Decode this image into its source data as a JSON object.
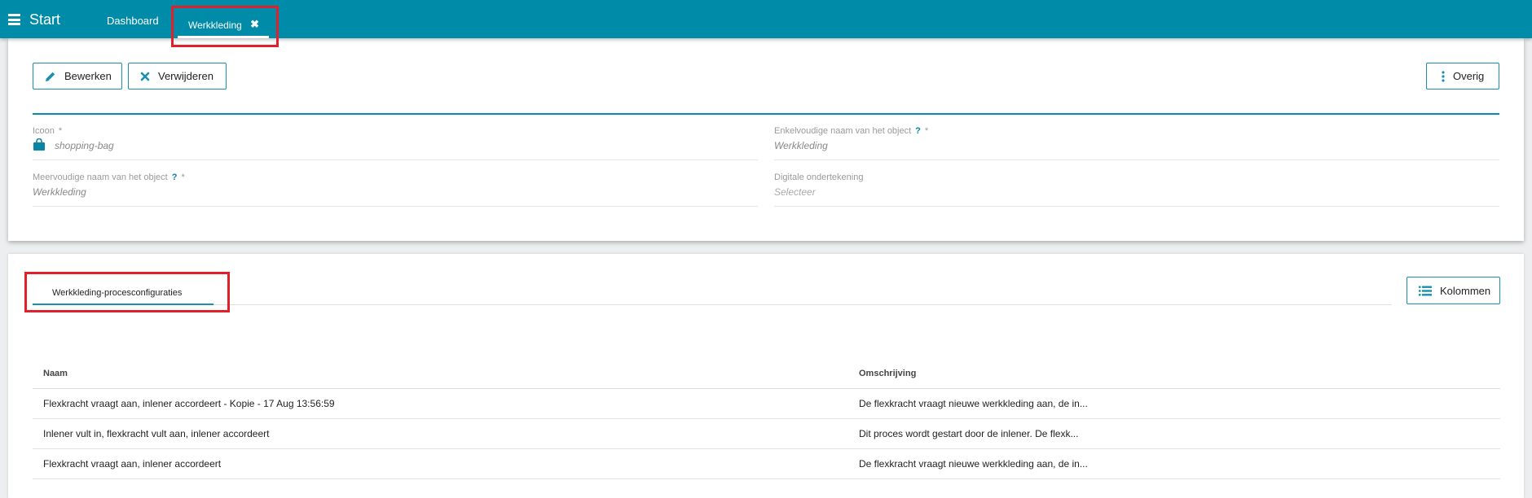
{
  "topbar": {
    "menu_label": "Start",
    "tabs": [
      {
        "label": "Dashboard"
      },
      {
        "label": "Werkkleding",
        "close": "✖"
      }
    ],
    "color": "#008ba8"
  },
  "record": {
    "buttons": {
      "edit": "Bewerken",
      "delete": "Verwijderen",
      "more": "Overig"
    },
    "fields": {
      "icoon": {
        "label": "Icoon",
        "required": "*",
        "value": "shopping-bag",
        "icon": "shopping-bag-icon"
      },
      "enkelvoud": {
        "label": "Enkelvoudige naam van het object",
        "help": "?",
        "required": "*",
        "value": "Werkkleding"
      },
      "meervoud": {
        "label": "Meervoudige naam van het object",
        "help": "?",
        "required": "*",
        "value": "Werkkleding"
      },
      "ondertekening": {
        "label": "Digitale ondertekening",
        "placeholder": "Selecteer"
      }
    }
  },
  "related": {
    "tab_label": "Werkkleding-procesconfiguraties",
    "columns_button": "Kolommen",
    "table": {
      "headers": [
        "Naam",
        "Omschrijving"
      ],
      "rows": [
        [
          "Flexkracht vraagt aan, inlener accordeert - Kopie - 17 Aug 13:56:59",
          "De flexkracht vraagt nieuwe werkkleding aan, de in..."
        ],
        [
          "Inlener vult in, flexkracht vult aan, inlener accordeert",
          "Dit proces wordt gestart door de inlener. De flexk..."
        ],
        [
          "Flexkracht vraagt aan, inlener accordeert",
          "De flexkracht vraagt nieuwe werkkleding aan, de in..."
        ]
      ]
    }
  },
  "accent_color": "#1a8fae",
  "highlight_color": "#e0202a"
}
